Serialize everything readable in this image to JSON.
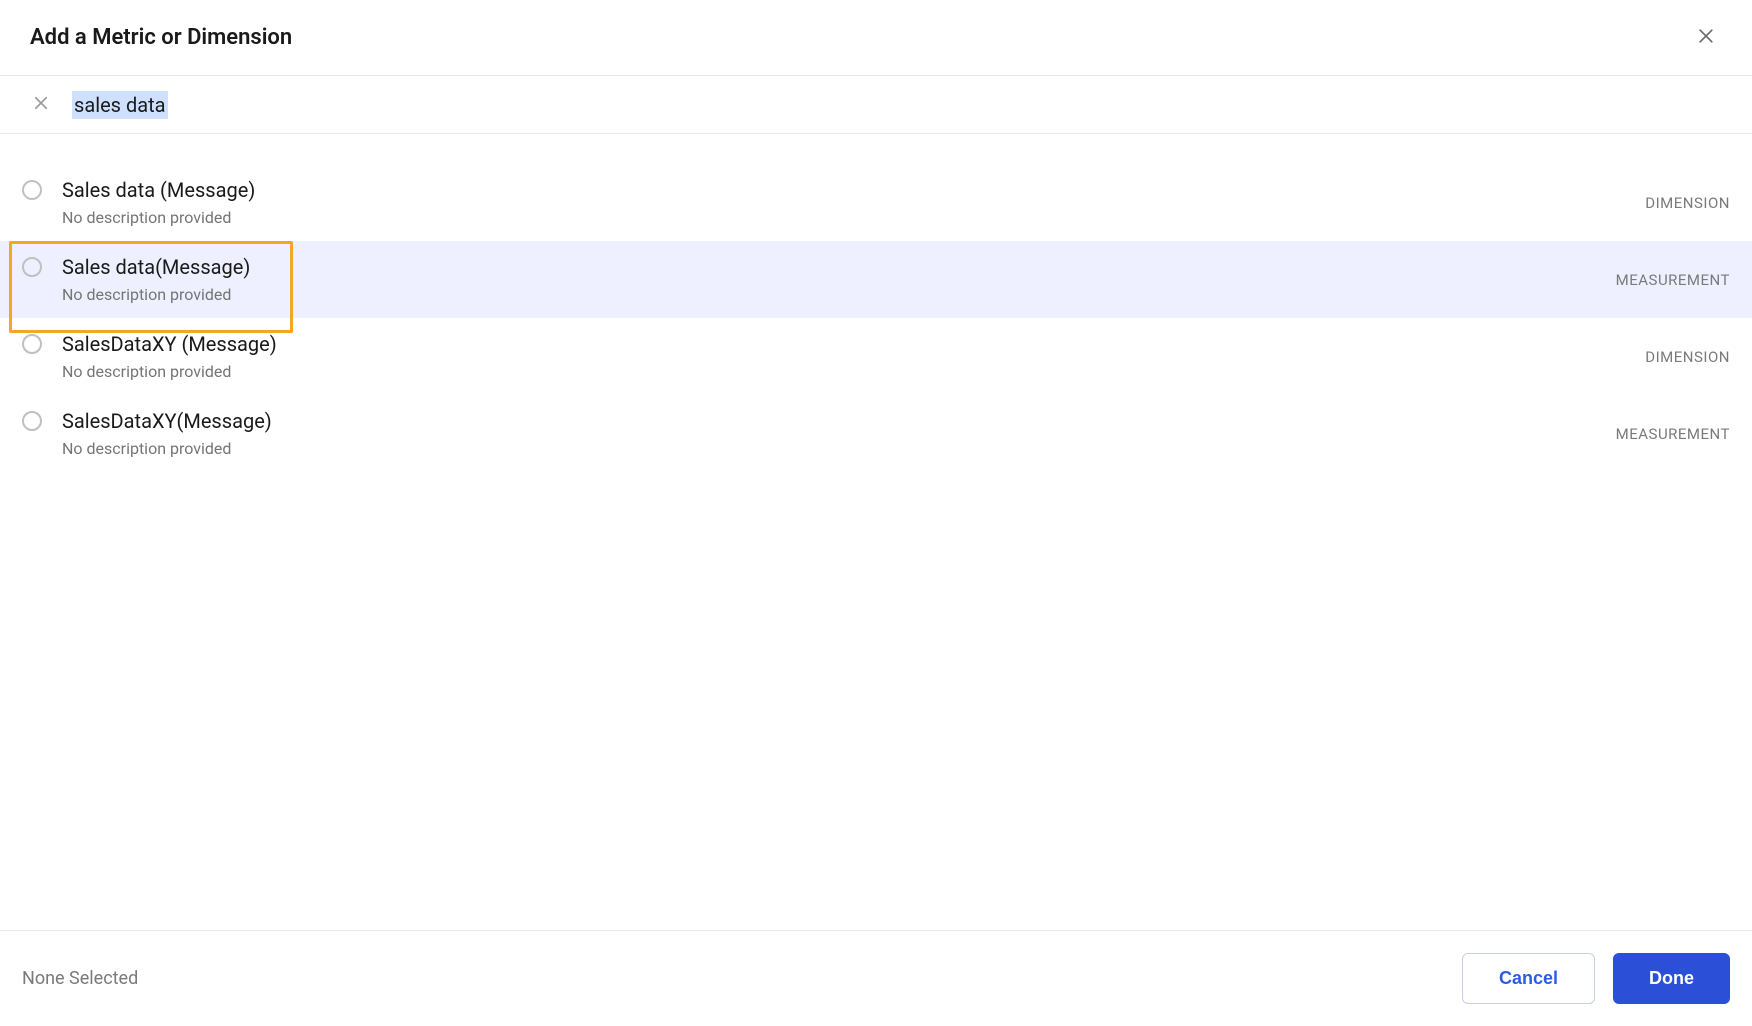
{
  "header": {
    "title": "Add a Metric or Dimension"
  },
  "search": {
    "value": "sales data"
  },
  "results": [
    {
      "title": "Sales data (Message)",
      "desc": "No description provided",
      "type": "DIMENSION",
      "highlighted": false,
      "boxed": false
    },
    {
      "title": "Sales data(Message)",
      "desc": "No description provided",
      "type": "MEASUREMENT",
      "highlighted": true,
      "boxed": true
    },
    {
      "title": "SalesDataXY (Message)",
      "desc": "No description provided",
      "type": "DIMENSION",
      "highlighted": false,
      "boxed": false
    },
    {
      "title": "SalesDataXY(Message)",
      "desc": "No description provided",
      "type": "MEASUREMENT",
      "highlighted": false,
      "boxed": false
    }
  ],
  "footer": {
    "status": "None Selected",
    "cancel": "Cancel",
    "done": "Done"
  }
}
